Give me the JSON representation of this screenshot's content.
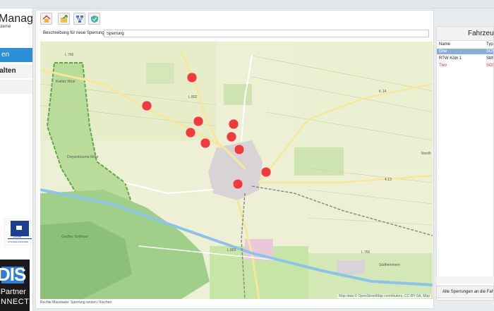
{
  "app": {
    "title": "Manager",
    "subtitle": "ysteme"
  },
  "sidebar": {
    "items": [
      {
        "label": "en"
      },
      {
        "label": "erwalten"
      }
    ]
  },
  "logos": {
    "lehrte": "Lehrte",
    "lehrte_sub": "SYSTEMLÖSUNGEN",
    "partner_big": "DIS",
    "partner_line1": "r Partner",
    "partner_line2": "ONNECT"
  },
  "toolbar": {
    "buttons": [
      "home-icon",
      "folder-arrow-icon",
      "network-icon",
      "shield-icon"
    ]
  },
  "form": {
    "label": "Beschreibung für neue Sperrung:",
    "value": "Sperrung"
  },
  "map": {
    "footer": "Rechte Maustaste: Sperrung setzen / löschen",
    "attribution": "Map data © OpenStreetMap contributors, CC-BY-SA, Map",
    "place_labels": [
      "L 766",
      "Kiebitz Moor",
      "Dreyenbourne Moor",
      "L 802",
      "K 14",
      "Nordh",
      "4.13",
      "Großes Torfmoor",
      "L 803",
      "Südhemmern",
      "L 766"
    ],
    "markers_count": 11
  },
  "vehicles": {
    "title": "Fahrzeuge",
    "columns": [
      "Name",
      "Typ"
    ],
    "rows": [
      {
        "name": "One",
        "type": "SOS",
        "selected": true,
        "color": "#ffffff"
      },
      {
        "name": "RTW Köln 1",
        "type": "SMS",
        "selected": false,
        "color": "#222222"
      },
      {
        "name": "Two",
        "type": "SOS",
        "selected": false,
        "color": "#d9302c"
      }
    ],
    "footer_button": "Alle Sperrungen an die Fahrzeuge"
  },
  "colors": {
    "accent": "#2d8fd5",
    "marker": "#ee3b3b",
    "selected_row": "#8aaed6"
  }
}
